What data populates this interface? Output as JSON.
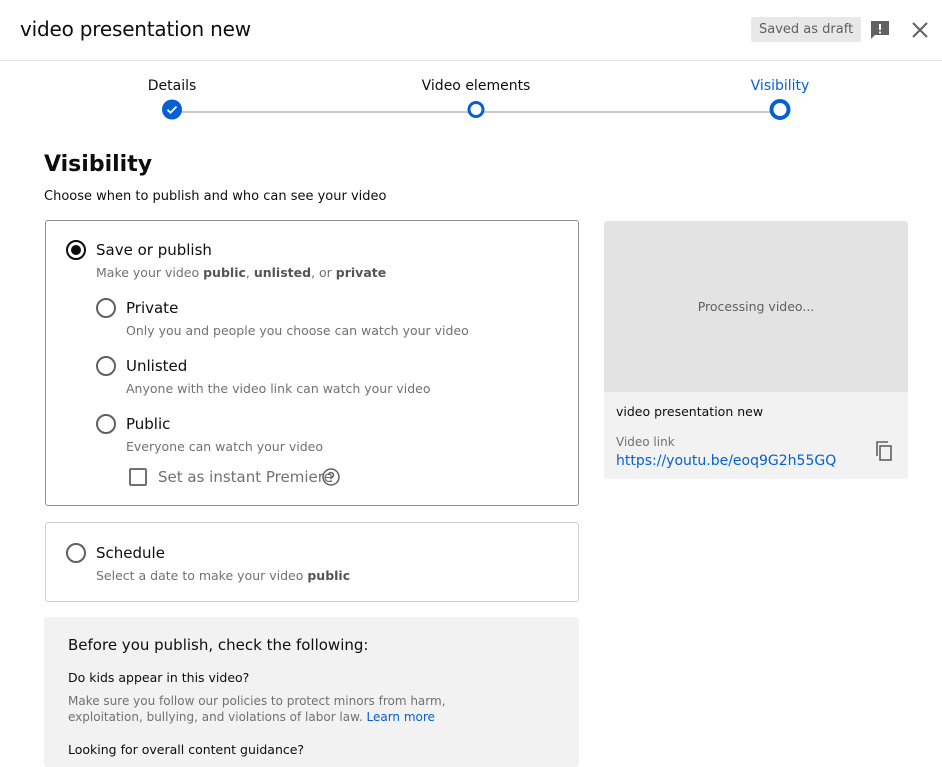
{
  "header": {
    "title": "video presentation new",
    "draft_badge": "Saved as draft"
  },
  "stepper": {
    "steps": [
      {
        "label": "Details",
        "state": "completed"
      },
      {
        "label": "Video elements",
        "state": "default"
      },
      {
        "label": "Visibility",
        "state": "active"
      }
    ]
  },
  "visibility": {
    "title": "Visibility",
    "subtitle": "Choose when to publish and who can see your video",
    "save_publish": {
      "label": "Save or publish",
      "desc_prefix": "Make your video ",
      "desc_b1": "public",
      "desc_sep1": ", ",
      "desc_b2": "unlisted",
      "desc_sep2": ", or ",
      "desc_b3": "private",
      "selected": true
    },
    "options": [
      {
        "label": "Private",
        "desc": "Only you and people you choose can watch your video"
      },
      {
        "label": "Unlisted",
        "desc": "Anyone with the video link can watch your video"
      },
      {
        "label": "Public",
        "desc": "Everyone can watch your video"
      }
    ],
    "premiere_label": "Set as instant Premiere",
    "schedule": {
      "label": "Schedule",
      "desc_prefix": "Select a date to make your video ",
      "desc_b": "public"
    }
  },
  "checklist": {
    "title": "Before you publish, check the following:",
    "q1": "Do kids appear in this video?",
    "text1": "Make sure you follow our policies to protect minors from harm, exploitation, bullying, and violations of labor law.",
    "learn_more": "Learn more",
    "q2": "Looking for overall content guidance?"
  },
  "preview": {
    "processing": "Processing video...",
    "title": "video presentation new",
    "video_link_label": "Video link",
    "video_link": "https://youtu.be/eoq9G2h55GQ"
  },
  "colors": {
    "accent": "#065fd4",
    "draft_badge_bg": "#e8e8e8"
  },
  "icons": [
    "feedback-icon",
    "close-icon",
    "check-icon",
    "help-icon",
    "copy-icon"
  ]
}
